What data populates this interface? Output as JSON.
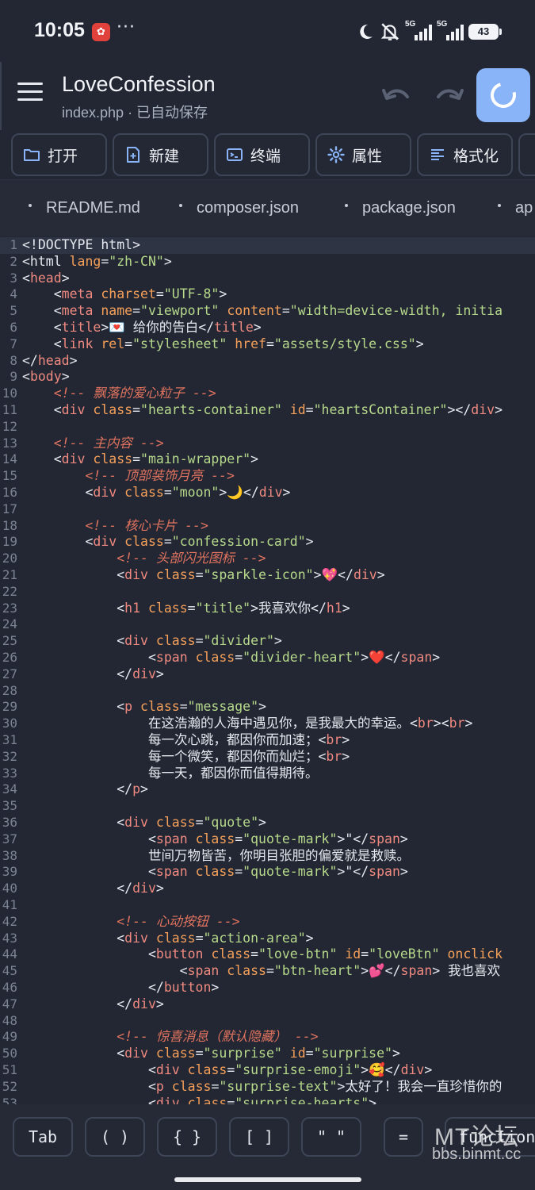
{
  "status_bar": {
    "time": "10:05",
    "app_icon": "app-notification-icon",
    "dots": "···",
    "signal1_label": "5G",
    "signal2_label": "5G",
    "battery": "43"
  },
  "app_bar": {
    "title": "LoveConfession",
    "subtitle": "index.php · 已自动保存"
  },
  "toolbar": {
    "buttons": [
      {
        "label": "打开",
        "icon": "folder-icon"
      },
      {
        "label": "新建",
        "icon": "new-file-icon"
      },
      {
        "label": "终端",
        "icon": "terminal-icon"
      },
      {
        "label": "属性",
        "icon": "gear-icon"
      },
      {
        "label": "格式化",
        "icon": "format-icon"
      }
    ]
  },
  "file_tabs": [
    "README.md",
    "composer.json",
    "package.json",
    "ap"
  ],
  "editor": {
    "lines": [
      [
        [
          "t",
          "<!DOCTYPE html>"
        ]
      ],
      [
        [
          "t",
          "<html "
        ],
        [
          "a",
          "lang"
        ],
        [
          "t",
          "="
        ],
        [
          "s",
          "\"zh-CN\""
        ],
        [
          "t",
          ">"
        ]
      ],
      [
        [
          "t",
          "<"
        ],
        [
          "g",
          "head"
        ],
        [
          "t",
          ">"
        ]
      ],
      [
        [
          "t",
          "    <"
        ],
        [
          "g",
          "meta "
        ],
        [
          "a",
          "charset"
        ],
        [
          "t",
          "="
        ],
        [
          "s",
          "\"UTF-8\""
        ],
        [
          "t",
          ">"
        ]
      ],
      [
        [
          "t",
          "    <"
        ],
        [
          "g",
          "meta "
        ],
        [
          "a",
          "name"
        ],
        [
          "t",
          "="
        ],
        [
          "s",
          "\"viewport\" "
        ],
        [
          "a",
          "content"
        ],
        [
          "t",
          "="
        ],
        [
          "s",
          "\"width=device-width, initia"
        ]
      ],
      [
        [
          "t",
          "    <"
        ],
        [
          "g",
          "title"
        ],
        [
          "t",
          ">💌 给你的告白</"
        ],
        [
          "g",
          "title"
        ],
        [
          "t",
          ">"
        ]
      ],
      [
        [
          "t",
          "    <"
        ],
        [
          "g",
          "link "
        ],
        [
          "a",
          "rel"
        ],
        [
          "t",
          "="
        ],
        [
          "s",
          "\"stylesheet\" "
        ],
        [
          "a",
          "href"
        ],
        [
          "t",
          "="
        ],
        [
          "s",
          "\"assets/style.css\""
        ],
        [
          "t",
          ">"
        ]
      ],
      [
        [
          "t",
          "</"
        ],
        [
          "g",
          "head"
        ],
        [
          "t",
          ">"
        ]
      ],
      [
        [
          "t",
          "<"
        ],
        [
          "g",
          "body"
        ],
        [
          "t",
          ">"
        ]
      ],
      [
        [
          "c",
          "    <!-- 飘落的爱心粒子 -->"
        ]
      ],
      [
        [
          "t",
          "    <"
        ],
        [
          "g",
          "div "
        ],
        [
          "a",
          "class"
        ],
        [
          "t",
          "="
        ],
        [
          "s",
          "\"hearts-container\" "
        ],
        [
          "a",
          "id"
        ],
        [
          "t",
          "="
        ],
        [
          "s",
          "\"heartsContainer\""
        ],
        [
          "t",
          "></"
        ],
        [
          "g",
          "div"
        ],
        [
          "t",
          ">"
        ]
      ],
      [
        [
          "t",
          ""
        ]
      ],
      [
        [
          "c",
          "    <!-- 主内容 -->"
        ]
      ],
      [
        [
          "t",
          "    <"
        ],
        [
          "g",
          "div "
        ],
        [
          "a",
          "class"
        ],
        [
          "t",
          "="
        ],
        [
          "s",
          "\"main-wrapper\""
        ],
        [
          "t",
          ">"
        ]
      ],
      [
        [
          "c",
          "        <!-- 顶部装饰月亮 -->"
        ]
      ],
      [
        [
          "t",
          "        <"
        ],
        [
          "g",
          "div "
        ],
        [
          "a",
          "class"
        ],
        [
          "t",
          "="
        ],
        [
          "s",
          "\"moon\""
        ],
        [
          "t",
          ">🌙</"
        ],
        [
          "g",
          "div"
        ],
        [
          "t",
          ">"
        ]
      ],
      [
        [
          "t",
          ""
        ]
      ],
      [
        [
          "c",
          "        <!-- 核心卡片 -->"
        ]
      ],
      [
        [
          "t",
          "        <"
        ],
        [
          "g",
          "div "
        ],
        [
          "a",
          "class"
        ],
        [
          "t",
          "="
        ],
        [
          "s",
          "\"confession-card\""
        ],
        [
          "t",
          ">"
        ]
      ],
      [
        [
          "c",
          "            <!-- 头部闪光图标 -->"
        ]
      ],
      [
        [
          "t",
          "            <"
        ],
        [
          "g",
          "div "
        ],
        [
          "a",
          "class"
        ],
        [
          "t",
          "="
        ],
        [
          "s",
          "\"sparkle-icon\""
        ],
        [
          "t",
          ">💖</"
        ],
        [
          "g",
          "div"
        ],
        [
          "t",
          ">"
        ]
      ],
      [
        [
          "t",
          ""
        ]
      ],
      [
        [
          "t",
          "            <"
        ],
        [
          "g",
          "h1 "
        ],
        [
          "a",
          "class"
        ],
        [
          "t",
          "="
        ],
        [
          "s",
          "\"title\""
        ],
        [
          "t",
          ">我喜欢你</"
        ],
        [
          "g",
          "h1"
        ],
        [
          "t",
          ">"
        ]
      ],
      [
        [
          "t",
          ""
        ]
      ],
      [
        [
          "t",
          "            <"
        ],
        [
          "g",
          "div "
        ],
        [
          "a",
          "class"
        ],
        [
          "t",
          "="
        ],
        [
          "s",
          "\"divider\""
        ],
        [
          "t",
          ">"
        ]
      ],
      [
        [
          "t",
          "                <"
        ],
        [
          "g",
          "span "
        ],
        [
          "a",
          "class"
        ],
        [
          "t",
          "="
        ],
        [
          "s",
          "\"divider-heart\""
        ],
        [
          "t",
          ">❤️</"
        ],
        [
          "g",
          "span"
        ],
        [
          "t",
          ">"
        ]
      ],
      [
        [
          "t",
          "            </"
        ],
        [
          "g",
          "div"
        ],
        [
          "t",
          ">"
        ]
      ],
      [
        [
          "t",
          ""
        ]
      ],
      [
        [
          "t",
          "            <"
        ],
        [
          "g",
          "p "
        ],
        [
          "a",
          "class"
        ],
        [
          "t",
          "="
        ],
        [
          "s",
          "\"message\""
        ],
        [
          "t",
          ">"
        ]
      ],
      [
        [
          "t",
          "                在这浩瀚的人海中遇见你，是我最大的幸运。<"
        ],
        [
          "g",
          "br"
        ],
        [
          "t",
          "><"
        ],
        [
          "g",
          "br"
        ],
        [
          "t",
          ">"
        ]
      ],
      [
        [
          "t",
          "                每一次心跳，都因你而加速；<"
        ],
        [
          "g",
          "br"
        ],
        [
          "t",
          ">"
        ]
      ],
      [
        [
          "t",
          "                每一个微笑，都因你而灿烂；<"
        ],
        [
          "g",
          "br"
        ],
        [
          "t",
          ">"
        ]
      ],
      [
        [
          "t",
          "                每一天，都因你而值得期待。"
        ]
      ],
      [
        [
          "t",
          "            </"
        ],
        [
          "g",
          "p"
        ],
        [
          "t",
          ">"
        ]
      ],
      [
        [
          "t",
          ""
        ]
      ],
      [
        [
          "t",
          "            <"
        ],
        [
          "g",
          "div "
        ],
        [
          "a",
          "class"
        ],
        [
          "t",
          "="
        ],
        [
          "s",
          "\"quote\""
        ],
        [
          "t",
          ">"
        ]
      ],
      [
        [
          "t",
          "                <"
        ],
        [
          "g",
          "span "
        ],
        [
          "a",
          "class"
        ],
        [
          "t",
          "="
        ],
        [
          "s",
          "\"quote-mark\""
        ],
        [
          "t",
          ">\"</"
        ],
        [
          "g",
          "span"
        ],
        [
          "t",
          ">"
        ]
      ],
      [
        [
          "t",
          "                世间万物皆苦，你明目张胆的偏爱就是救赎。"
        ]
      ],
      [
        [
          "t",
          "                <"
        ],
        [
          "g",
          "span "
        ],
        [
          "a",
          "class"
        ],
        [
          "t",
          "="
        ],
        [
          "s",
          "\"quote-mark\""
        ],
        [
          "t",
          ">\"</"
        ],
        [
          "g",
          "span"
        ],
        [
          "t",
          ">"
        ]
      ],
      [
        [
          "t",
          "            </"
        ],
        [
          "g",
          "div"
        ],
        [
          "t",
          ">"
        ]
      ],
      [
        [
          "t",
          ""
        ]
      ],
      [
        [
          "c",
          "            <!-- 心动按钮 -->"
        ]
      ],
      [
        [
          "t",
          "            <"
        ],
        [
          "g",
          "div "
        ],
        [
          "a",
          "class"
        ],
        [
          "t",
          "="
        ],
        [
          "s",
          "\"action-area\""
        ],
        [
          "t",
          ">"
        ]
      ],
      [
        [
          "t",
          "                <"
        ],
        [
          "g",
          "button "
        ],
        [
          "a",
          "class"
        ],
        [
          "t",
          "="
        ],
        [
          "s",
          "\"love-btn\" "
        ],
        [
          "a",
          "id"
        ],
        [
          "t",
          "="
        ],
        [
          "s",
          "\"loveBtn\" "
        ],
        [
          "a",
          "onclick"
        ]
      ],
      [
        [
          "t",
          "                    <"
        ],
        [
          "g",
          "span "
        ],
        [
          "a",
          "class"
        ],
        [
          "t",
          "="
        ],
        [
          "s",
          "\"btn-heart\""
        ],
        [
          "t",
          ">💕</"
        ],
        [
          "g",
          "span"
        ],
        [
          "t",
          "> 我也喜欢"
        ]
      ],
      [
        [
          "t",
          "                </"
        ],
        [
          "g",
          "button"
        ],
        [
          "t",
          ">"
        ]
      ],
      [
        [
          "t",
          "            </"
        ],
        [
          "g",
          "div"
        ],
        [
          "t",
          ">"
        ]
      ],
      [
        [
          "t",
          ""
        ]
      ],
      [
        [
          "c",
          "            <!-- 惊喜消息（默认隐藏） -->"
        ]
      ],
      [
        [
          "t",
          "            <"
        ],
        [
          "g",
          "div "
        ],
        [
          "a",
          "class"
        ],
        [
          "t",
          "="
        ],
        [
          "s",
          "\"surprise\" "
        ],
        [
          "a",
          "id"
        ],
        [
          "t",
          "="
        ],
        [
          "s",
          "\"surprise\""
        ],
        [
          "t",
          ">"
        ]
      ],
      [
        [
          "t",
          "                <"
        ],
        [
          "g",
          "div "
        ],
        [
          "a",
          "class"
        ],
        [
          "t",
          "="
        ],
        [
          "s",
          "\"surprise-emoji\""
        ],
        [
          "t",
          ">🥰</"
        ],
        [
          "g",
          "div"
        ],
        [
          "t",
          ">"
        ]
      ],
      [
        [
          "t",
          "                <"
        ],
        [
          "g",
          "p "
        ],
        [
          "a",
          "class"
        ],
        [
          "t",
          "="
        ],
        [
          "s",
          "\"surprise-text\""
        ],
        [
          "t",
          ">太好了！我会一直珍惜你的"
        ]
      ],
      [
        [
          "t",
          "                <"
        ],
        [
          "g",
          "div "
        ],
        [
          "a",
          "class"
        ],
        [
          "t",
          "="
        ],
        [
          "s",
          "\"surprise-hearts\""
        ],
        [
          "t",
          ">"
        ]
      ]
    ]
  },
  "keybar": {
    "keys": [
      "Tab",
      "( )",
      "{ }",
      "[ ]",
      "\" \"",
      "=",
      "function"
    ]
  },
  "watermark": {
    "title": "MT论坛",
    "url": "bbs.binmt.cc"
  }
}
